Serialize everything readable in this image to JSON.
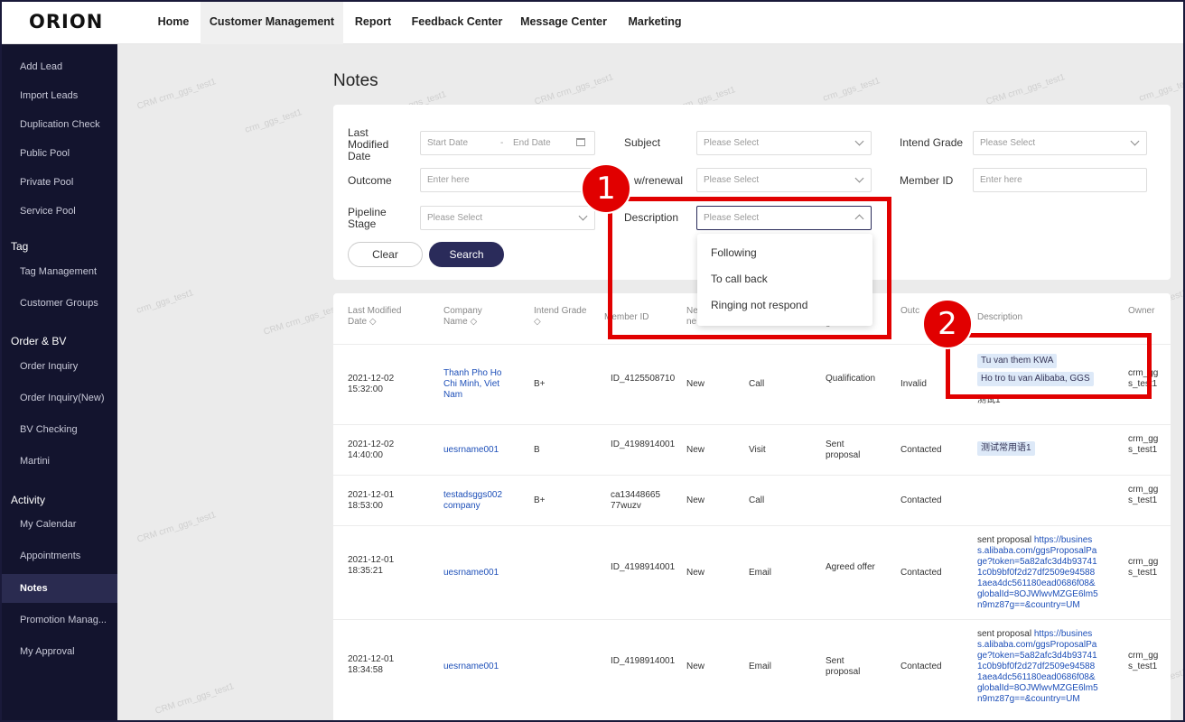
{
  "logo": "ORION",
  "nav": [
    "Home",
    "Customer Management",
    "Report",
    "Feedback Center",
    "Message Center",
    "Marketing"
  ],
  "sidebar": {
    "g1": [
      "Add Lead",
      "Import Leads",
      "Duplication Check",
      "Public Pool",
      "Private Pool",
      "Service Pool"
    ],
    "tag_head": "Tag",
    "tag_items": [
      "Tag Management",
      "Customer Groups"
    ],
    "order_head": "Order & BV",
    "order_items": [
      "Order Inquiry",
      "Order Inquiry(New)",
      "BV Checking",
      "Martini"
    ],
    "activity_head": "Activity",
    "activity_items": [
      "My Calendar",
      "Appointments",
      "Notes",
      "Promotion Manag...",
      "My Approval"
    ]
  },
  "watermark": "crm_ggs_test1",
  "watermark_short": "CRM",
  "page_title": "Notes",
  "filters": {
    "last_modified": "Last Modified Date",
    "start_ph": "Start Date",
    "end_ph": "End Date",
    "dash": "-",
    "subject": "Subject",
    "intend_grade": "Intend Grade",
    "outcome": "Outcome",
    "newrenewal": "w/renewal",
    "member_id": "Member ID",
    "pipeline": "Pipeline Stage",
    "description": "Description",
    "please_select": "Please Select",
    "enter_here": "Enter here",
    "clear": "Clear",
    "search": "Search"
  },
  "dropdown": [
    "Following",
    "To call back",
    "Ringing not respond"
  ],
  "columns": {
    "last_modified": "Last Modified Date",
    "company": "Company Name",
    "intend_grade": "Intend Grade",
    "member_id": "Member ID",
    "ne": "Ne ne",
    "ge": "ge",
    "outc": "Outc",
    "description": "Description",
    "owner": "Owner"
  },
  "rows": [
    {
      "date": "2021-12-02 15:32:00",
      "company": "Thanh Pho Ho Chi Minh, Viet Nam",
      "grade": "B+",
      "member": "ID_4125508710",
      "status": "New",
      "type": "Call",
      "stage": "Qualification",
      "outcome": "Invalid",
      "tags": [
        "Tu van them KWA",
        "Ho tro tu van Alibaba, GGS"
      ],
      "desc_text": "测试1",
      "owner": "crm_ggs_test1"
    },
    {
      "date": "2021-12-02 14:40:00",
      "company": "uesrname001",
      "grade": "B",
      "member": "ID_4198914001",
      "status": "New",
      "type": "Visit",
      "stage": "Sent proposal",
      "outcome": "Contacted",
      "tags": [
        "测试常用语1"
      ],
      "owner": "crm_ggs_test1"
    },
    {
      "date": "2021-12-01 18:53:00",
      "company": "testadsggs002 company",
      "grade": "B+",
      "member": "ca1344866577wuzv",
      "status": "New",
      "type": "Call",
      "stage": "",
      "outcome": "Contacted",
      "owner": "crm_ggs_test1"
    },
    {
      "date": "2021-12-01 18:35:21",
      "company": "uesrname001",
      "grade": "",
      "member": "ID_4198914001",
      "status": "New",
      "type": "Email",
      "stage": "Agreed offer",
      "outcome": "Contacted",
      "desc_prefix": "sent proposal",
      "desc_link": "https://business.alibaba.com/ggsProposalPage?token=5a82afc3d4b937411c0b9bf0f2d27df2509e945881aea4dc561180ead0686f08&globalId=8OJWlwvMZGE6lm5n9mz87g==&country=UM",
      "owner": "crm_ggs_test1"
    },
    {
      "date": "2021-12-01 18:34:58",
      "company": "uesrname001",
      "grade": "",
      "member": "ID_4198914001",
      "status": "New",
      "type": "Email",
      "stage": "Sent proposal",
      "outcome": "Contacted",
      "desc_prefix": "sent proposal",
      "desc_link": "https://business.alibaba.com/ggsProposalPage?token=5a82afc3d4b937411c0b9bf0f2d27df2509e945881aea4dc561180ead0686f08&globalId=8OJWlwvMZGE6lm5n9mz87g==&country=UM",
      "owner": "crm_ggs_test1"
    }
  ],
  "callouts": [
    "1",
    "2"
  ],
  "colors": {
    "sidebar": "#13142e",
    "accent": "#2a2b5a",
    "callout": "#e10000",
    "link": "#1d4fb8"
  }
}
